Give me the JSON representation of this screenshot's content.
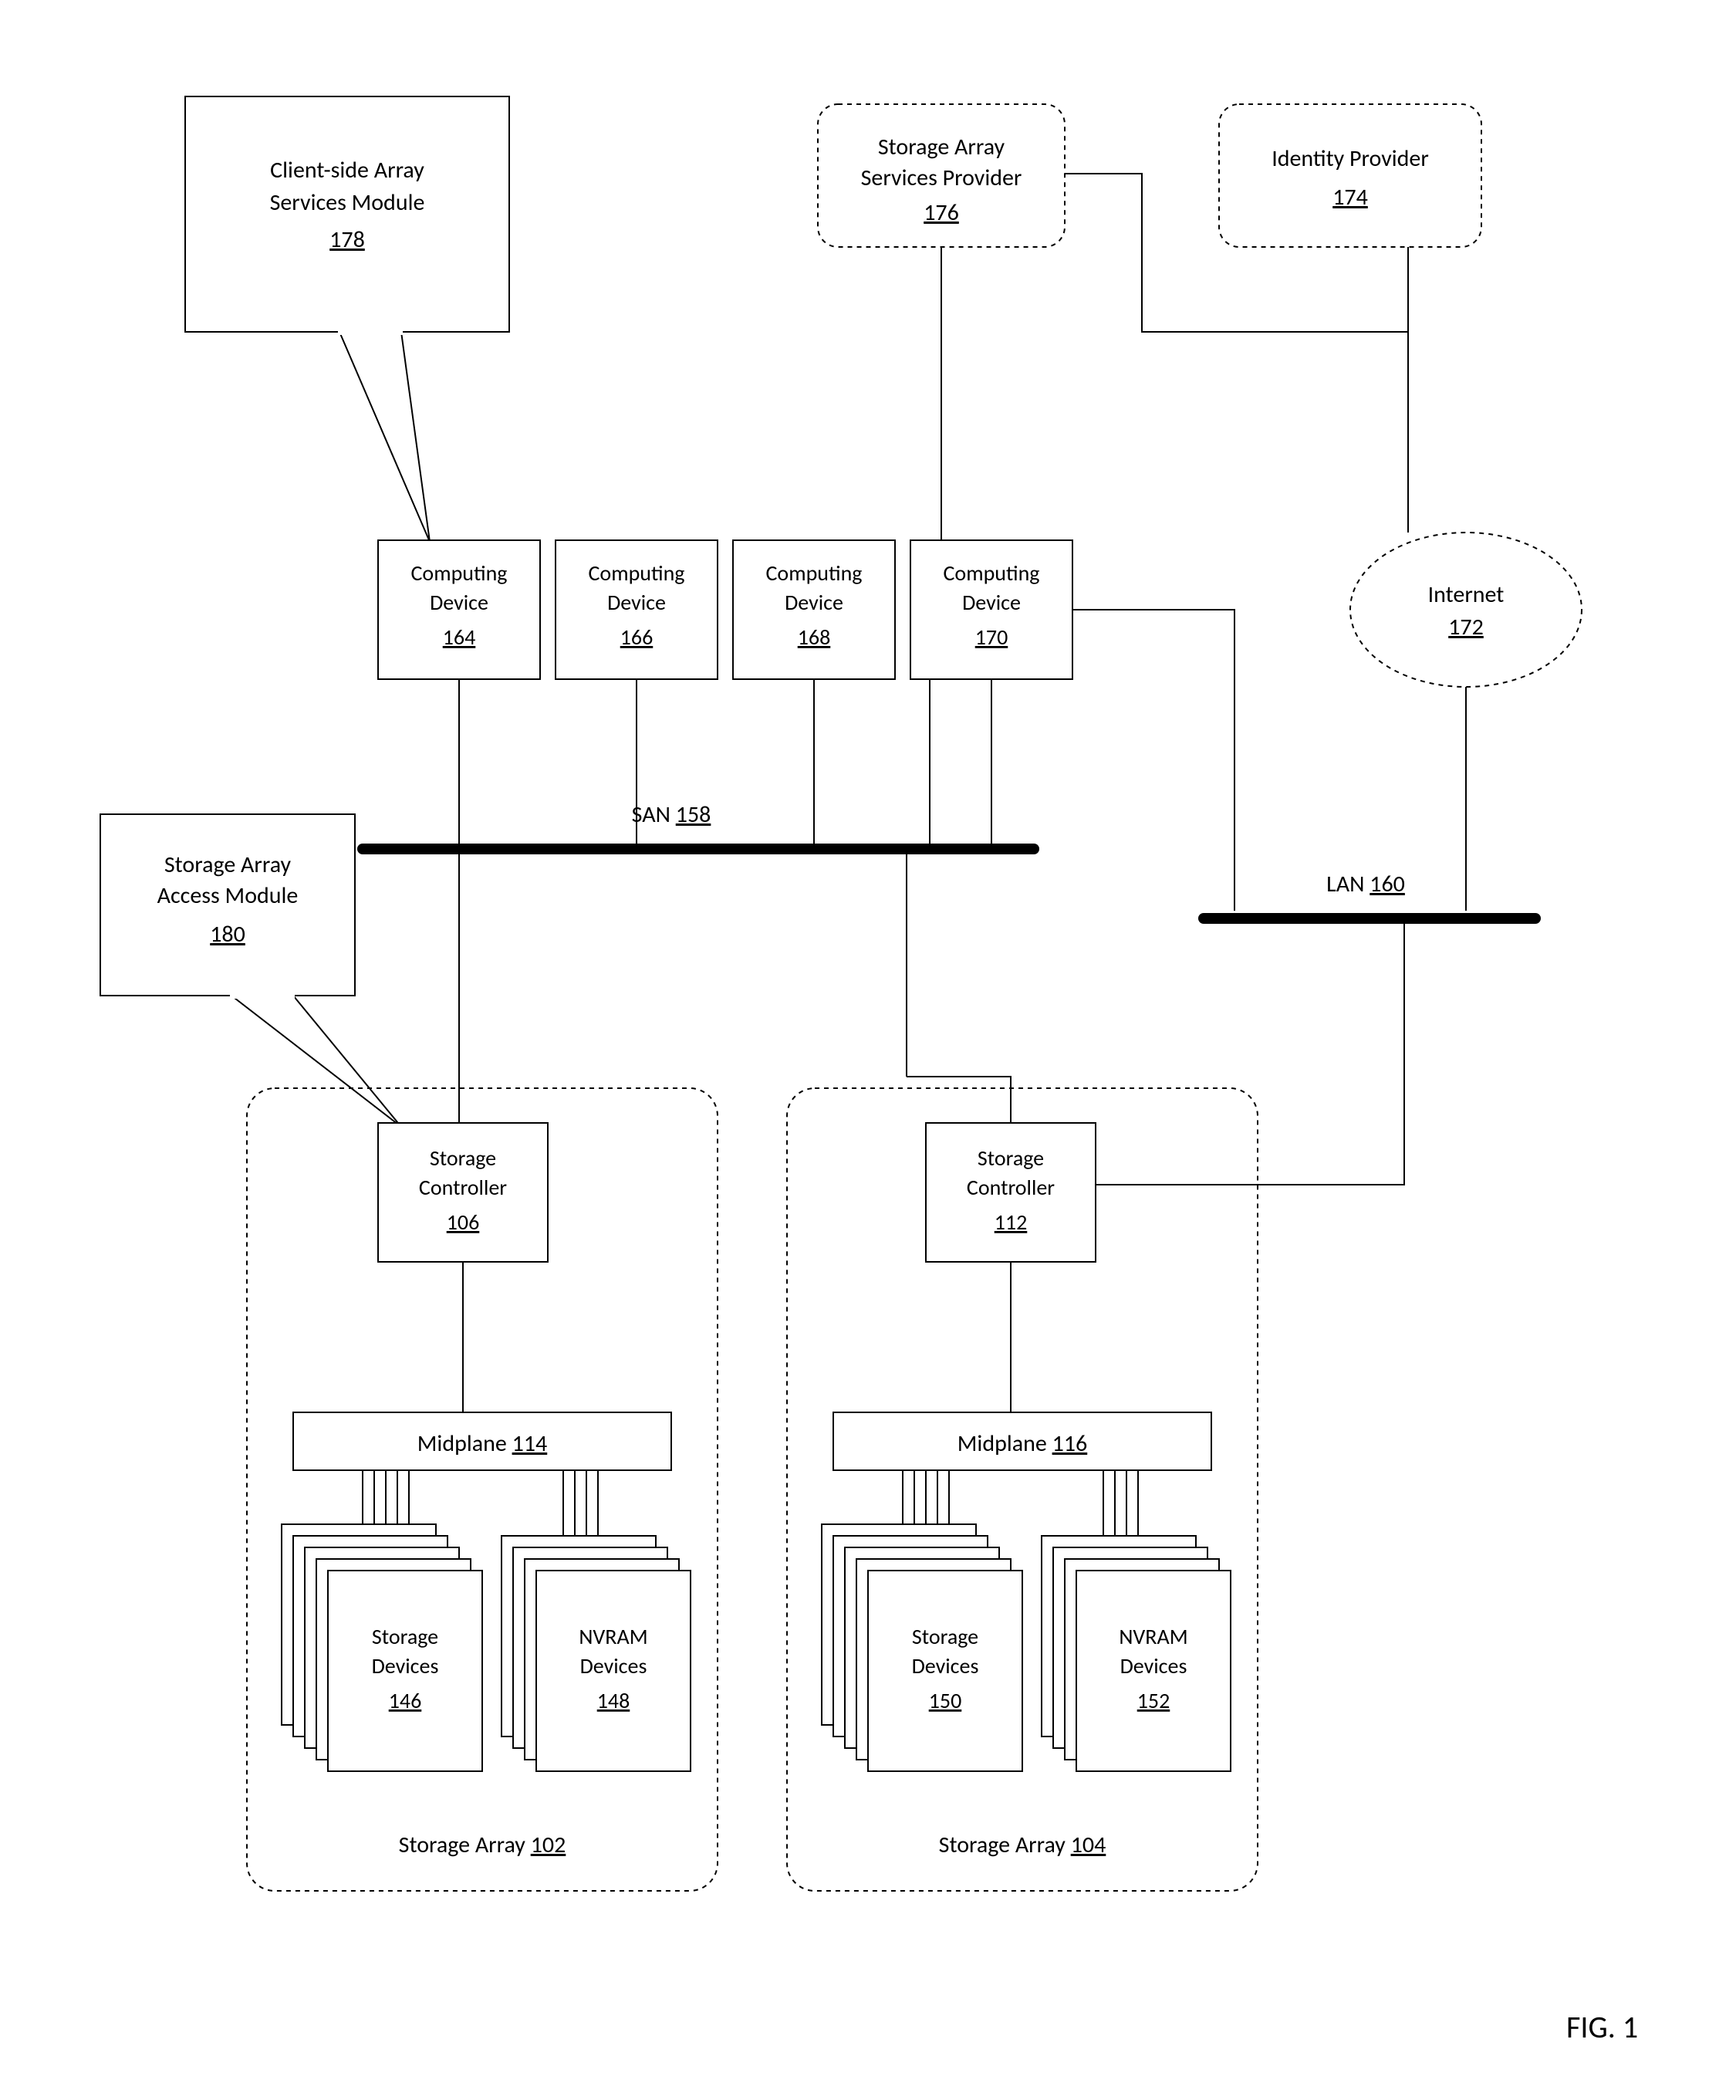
{
  "callout1": {
    "l1": "Client-side Array",
    "l2": "Services Module",
    "num": "178"
  },
  "callout2": {
    "l1": "Storage Array",
    "l2": "Access Module",
    "num": "180"
  },
  "sasp": {
    "l1": "Storage Array",
    "l2": "Services Provider",
    "num": "176"
  },
  "idp": {
    "l1": "Identity Provider",
    "num": "174"
  },
  "cd1": {
    "l1": "Computing",
    "l2": "Device",
    "num": "164"
  },
  "cd2": {
    "l1": "Computing",
    "l2": "Device",
    "num": "166"
  },
  "cd3": {
    "l1": "Computing",
    "l2": "Device",
    "num": "168"
  },
  "cd4": {
    "l1": "Computing",
    "l2": "Device",
    "num": "170"
  },
  "san": {
    "label": "SAN",
    "num": "158"
  },
  "lan": {
    "label": "LAN",
    "num": "160"
  },
  "internet": {
    "label": "Internet",
    "num": "172"
  },
  "sc1": {
    "l1": "Storage",
    "l2": "Controller",
    "num": "106"
  },
  "sc2": {
    "l1": "Storage",
    "l2": "Controller",
    "num": "112"
  },
  "mp1": {
    "label": "Midplane",
    "num": "114"
  },
  "mp2": {
    "label": "Midplane",
    "num": "116"
  },
  "sd1": {
    "l1": "Storage",
    "l2": "Devices",
    "num": "146"
  },
  "nv1": {
    "l1": "NVRAM",
    "l2": "Devices",
    "num": "148"
  },
  "sd2": {
    "l1": "Storage",
    "l2": "Devices",
    "num": "150"
  },
  "nv2": {
    "l1": "NVRAM",
    "l2": "Devices",
    "num": "152"
  },
  "sa1": {
    "label": "Storage Array",
    "num": "102"
  },
  "sa2": {
    "label": "Storage Array",
    "num": "104"
  },
  "fig": "FIG. 1"
}
